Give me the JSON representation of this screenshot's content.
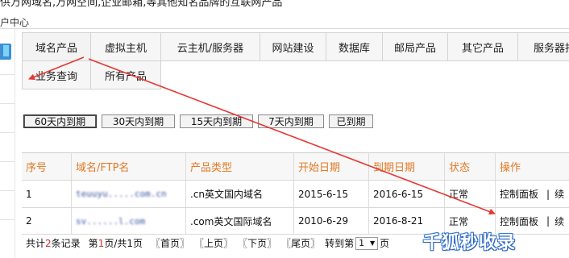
{
  "header": {
    "top_text": "供万网域名,万网空间,企业邮箱,等其他知名品牌的互联网产品",
    "breadcrumb": "户中心"
  },
  "tabs": [
    {
      "label": "域名产品",
      "active": true
    },
    {
      "label": "虚拟主机"
    },
    {
      "label": "云主机/服务器"
    },
    {
      "label": "网站建设"
    },
    {
      "label": "数据库"
    },
    {
      "label": "邮局产品"
    },
    {
      "label": "其它产品"
    },
    {
      "label": "服务器托"
    },
    {
      "label": "业务查询"
    },
    {
      "label": "所有产品"
    }
  ],
  "expiry_filters": [
    {
      "label": "60天内到期",
      "selected": true
    },
    {
      "label": "30天内到期"
    },
    {
      "label": "15天内到期"
    },
    {
      "label": "7天内到期"
    },
    {
      "label": "已到期"
    }
  ],
  "table": {
    "headers": [
      "序号",
      "域名/FTP名",
      "产品类型",
      "开始日期",
      "到期日期",
      "状态",
      "操作"
    ],
    "rows": [
      {
        "index": "1",
        "domain": "teuuyu.....com.cn",
        "type": ".cn英文国内域名",
        "start": "2015-6-15",
        "end": "2016-6-15",
        "status": "正常",
        "action1": "控制面板",
        "sep": "|",
        "action2": "续"
      },
      {
        "index": "2",
        "domain": "sv......l.com",
        "type": ".com英文国际域名",
        "start": "2010-6-29",
        "end": "2016-8-21",
        "status": "正常",
        "action1": "控制面板",
        "sep": "|",
        "action2": "续"
      }
    ]
  },
  "pagination": {
    "total_prefix": "共计",
    "total_count": "2",
    "total_suffix": "条记录",
    "page_prefix": "第",
    "current_page": "1",
    "page_mid": "页/共",
    "total_pages": "1",
    "page_suffix": "页",
    "first": "〖首页〗",
    "prev": "〖上页〗",
    "next": "〖下页〗",
    "last": "〖尾页〗",
    "goto_prefix": "转到第",
    "goto_value": "1",
    "goto_suffix": "页"
  },
  "watermark": "千狐秒收录",
  "colors": {
    "header_text": "#e07a25",
    "annotation_arrow": "#e53935",
    "count_highlight": "#d62f2f"
  }
}
